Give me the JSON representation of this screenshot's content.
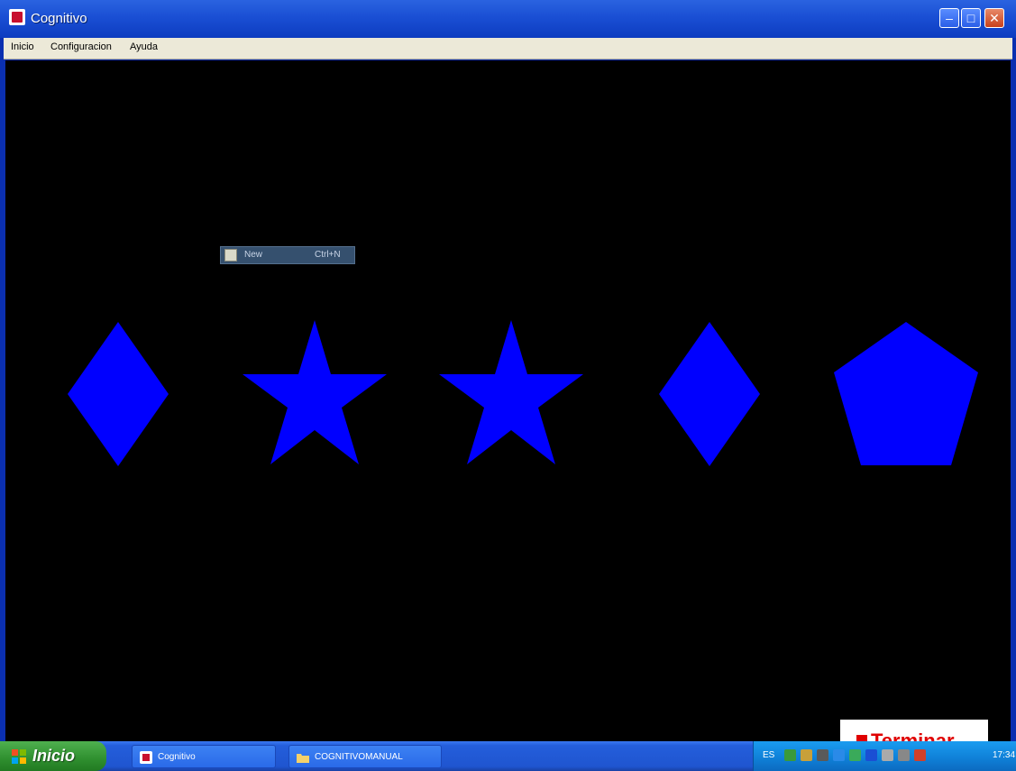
{
  "window": {
    "title": "Cognitivo",
    "controls": {
      "minimize": "–",
      "maximize": "□",
      "close": "✕"
    }
  },
  "menubar": {
    "items": [
      "Inicio",
      "Configuracion",
      "Ayuda"
    ]
  },
  "popup": {
    "icon": "new-document-icon",
    "label": "New",
    "shortcut": "Ctrl+N"
  },
  "shapes": [
    {
      "type": "diamond",
      "color": "#0000ff"
    },
    {
      "type": "star",
      "color": "#0000ff"
    },
    {
      "type": "star",
      "color": "#0000ff"
    },
    {
      "type": "diamond",
      "color": "#0000ff"
    },
    {
      "type": "pentagon",
      "color": "#0000ff"
    }
  ],
  "terminar_button": {
    "label": "Terminar",
    "color": "#e00000"
  },
  "taskbar": {
    "start_label": "Inicio",
    "tasks": [
      {
        "label": "Cognitivo",
        "icon": "app-icon"
      },
      {
        "label": "COGNITIVOMANUAL",
        "icon": "folder-icon"
      }
    ],
    "tray": {
      "language": "ES",
      "clock": "17:34",
      "icons": [
        "network-icon",
        "volume-icon",
        "security-icon",
        "update-icon",
        "display-icon",
        "bluetooth-icon",
        "shield-icon",
        "speaker-icon",
        "app-tray-icon"
      ]
    }
  }
}
